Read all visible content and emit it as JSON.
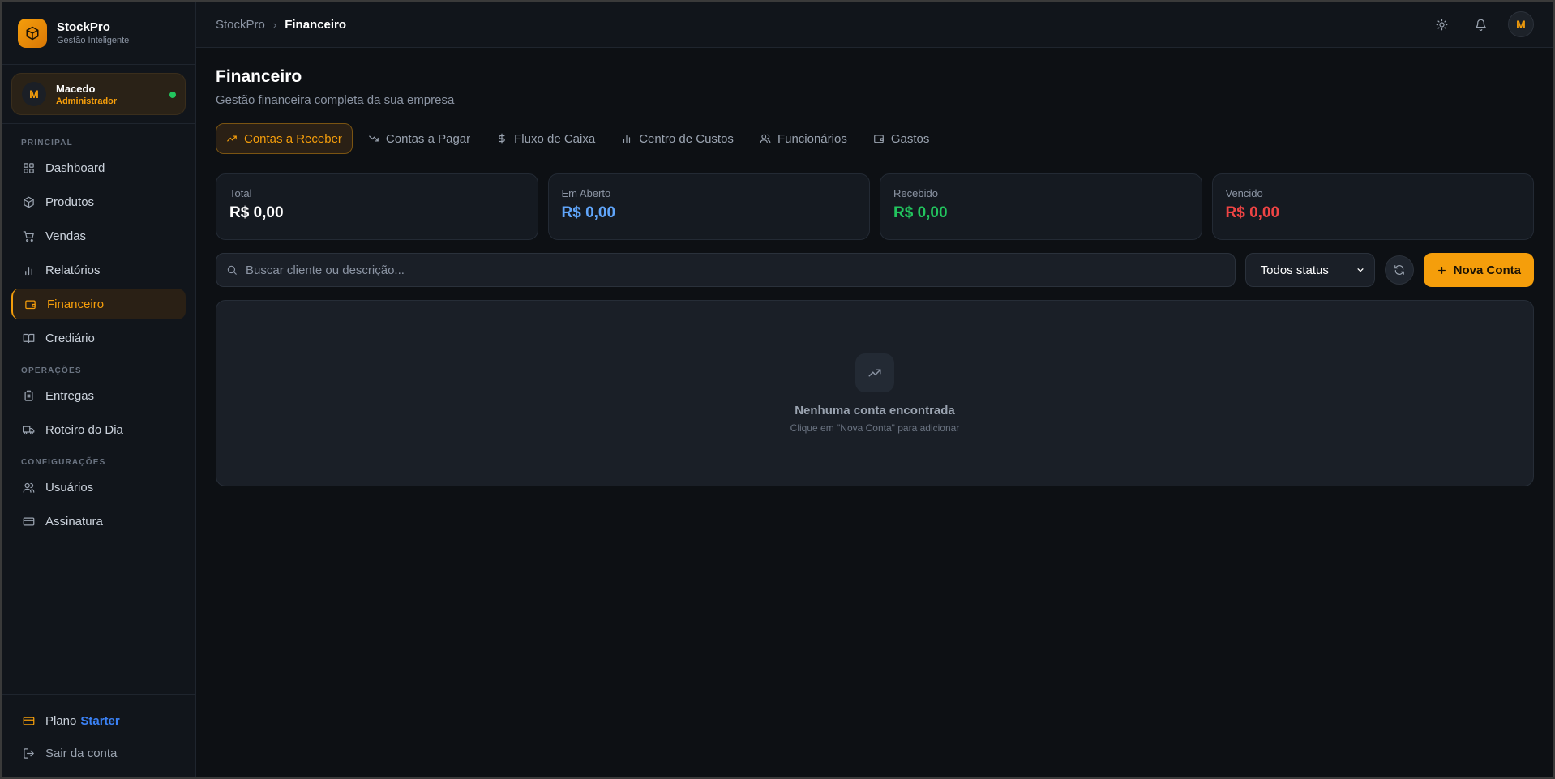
{
  "brand": {
    "name": "StockPro",
    "subtitle": "Gestão Inteligente",
    "logo_icon": "box-icon"
  },
  "user": {
    "initial": "M",
    "name": "Macedo",
    "role": "Administrador",
    "status_color": "#22c55e"
  },
  "sidebar": {
    "sections": [
      {
        "title": "PRINCIPAL",
        "items": [
          {
            "label": "Dashboard",
            "icon": "grid-icon"
          },
          {
            "label": "Produtos",
            "icon": "package-icon"
          },
          {
            "label": "Vendas",
            "icon": "cart-icon"
          },
          {
            "label": "Relatórios",
            "icon": "bar-chart-icon"
          },
          {
            "label": "Financeiro",
            "icon": "wallet-icon",
            "active": true
          },
          {
            "label": "Crediário",
            "icon": "book-icon"
          }
        ]
      },
      {
        "title": "OPERAÇÕES",
        "items": [
          {
            "label": "Entregas",
            "icon": "clipboard-icon"
          },
          {
            "label": "Roteiro do Dia",
            "icon": "truck-icon"
          }
        ]
      },
      {
        "title": "CONFIGURAÇÕES",
        "items": [
          {
            "label": "Usuários",
            "icon": "users-icon"
          },
          {
            "label": "Assinatura",
            "icon": "card-icon"
          }
        ]
      }
    ],
    "footer": {
      "plan_prefix": "Plano",
      "plan_name": "Starter",
      "logout": "Sair da conta"
    }
  },
  "topbar": {
    "crumb_root": "StockPro",
    "crumb_current": "Financeiro",
    "avatar_initial": "M"
  },
  "page": {
    "title": "Financeiro",
    "subtitle": "Gestão financeira completa da sua empresa"
  },
  "tabs": [
    {
      "label": "Contas a Receber",
      "icon": "trending-up-icon",
      "active": true
    },
    {
      "label": "Contas a Pagar",
      "icon": "trending-down-icon"
    },
    {
      "label": "Fluxo de Caixa",
      "icon": "dollar-icon"
    },
    {
      "label": "Centro de Custos",
      "icon": "bar-chart-icon"
    },
    {
      "label": "Funcionários",
      "icon": "users-icon"
    },
    {
      "label": "Gastos",
      "icon": "wallet-icon"
    }
  ],
  "stats": [
    {
      "label": "Total",
      "value": "R$ 0,00",
      "color": "#ffffff"
    },
    {
      "label": "Em Aberto",
      "value": "R$ 0,00",
      "color": "#60a5fa"
    },
    {
      "label": "Recebido",
      "value": "R$ 0,00",
      "color": "#22c55e"
    },
    {
      "label": "Vencido",
      "value": "R$ 0,00",
      "color": "#ef4444"
    }
  ],
  "toolbar": {
    "search_placeholder": "Buscar cliente ou descrição...",
    "status_selected": "Todos status",
    "new_button": "Nova Conta"
  },
  "empty": {
    "title": "Nenhuma conta encontrada",
    "subtitle": "Clique em \"Nova Conta\" para adicionar"
  },
  "colors": {
    "accent": "#f59e0b",
    "plan": "#3b82f6"
  }
}
